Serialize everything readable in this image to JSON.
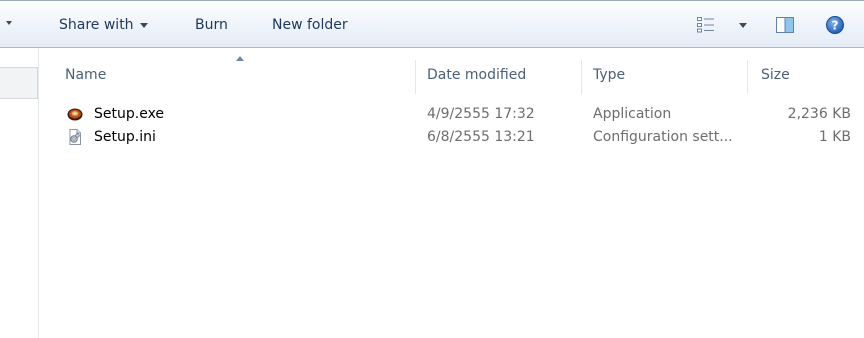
{
  "toolbar": {
    "share_with": "Share with",
    "burn": "Burn",
    "new_folder": "New folder",
    "icons": [
      "organize-dropdown-arrow",
      "view-options-icon",
      "preview-pane-icon",
      "help-icon"
    ]
  },
  "columns": {
    "name": "Name",
    "date_modified": "Date modified",
    "type": "Type",
    "size": "Size",
    "sorted_by": "Name",
    "sort_direction": "ascending"
  },
  "files": [
    {
      "name": "Setup.exe",
      "date_modified": "4/9/2555 17:32",
      "type": "Application",
      "size": "2,236 KB",
      "icon": "application-icon"
    },
    {
      "name": "Setup.ini",
      "date_modified": "6/8/2555 13:21",
      "type": "Configuration sett...",
      "size": "1 KB",
      "icon": "config-file-icon"
    }
  ],
  "colors": {
    "toolbar_text": "#1e395b",
    "header_text": "#4c607a",
    "detail_text": "#6d6d6d",
    "help_blue": "#1f5fb5"
  }
}
